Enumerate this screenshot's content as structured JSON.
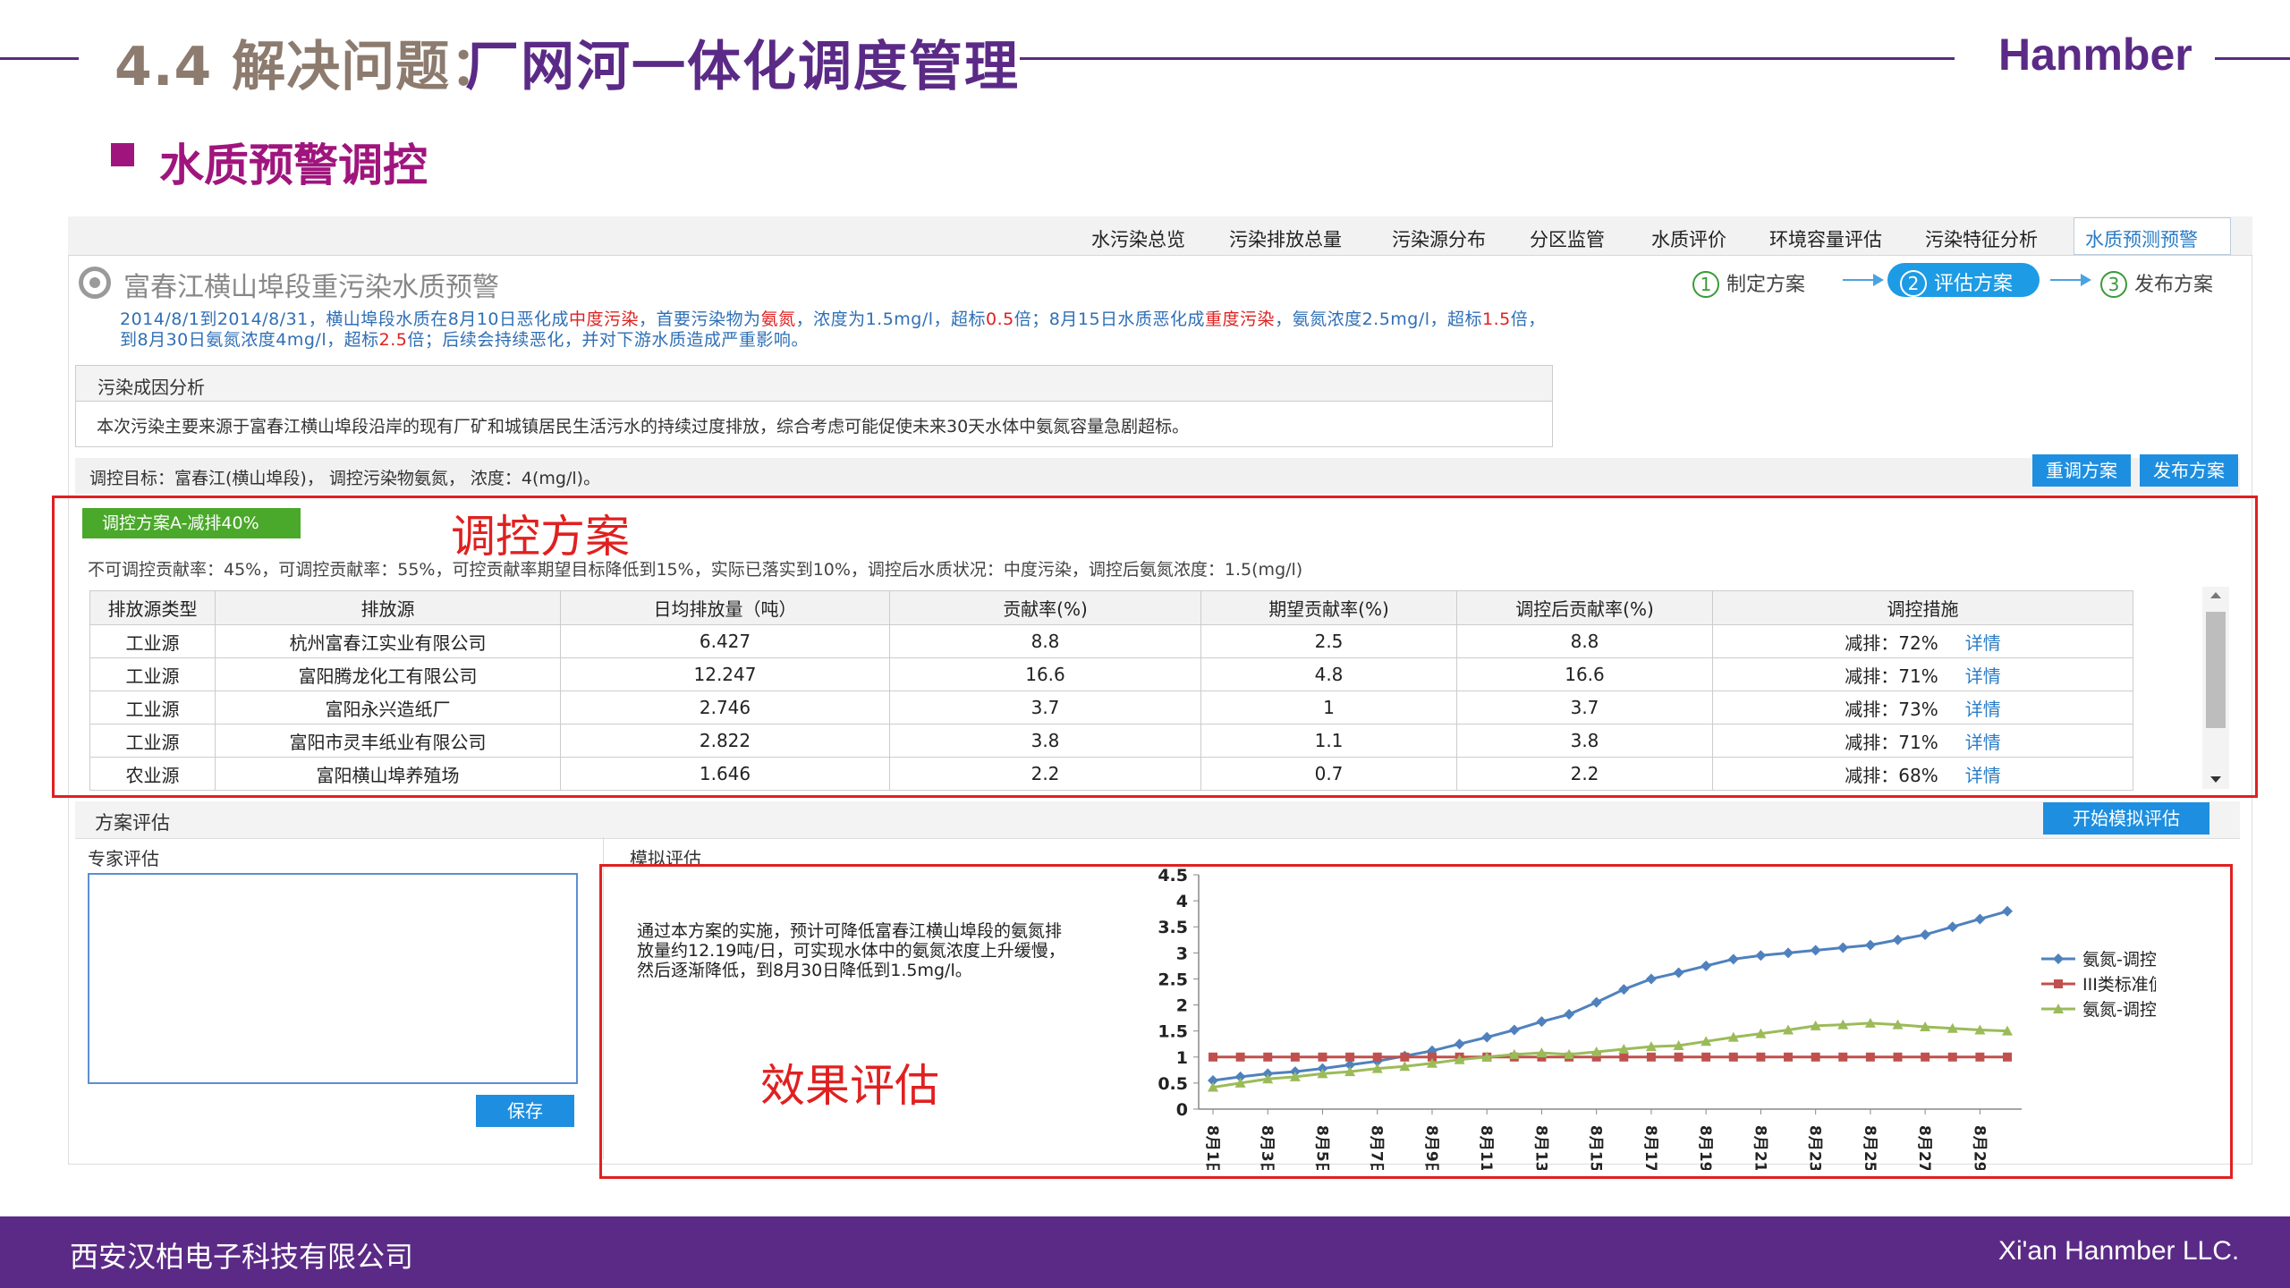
{
  "slide": {
    "title_num": "4.4 解决问题：",
    "title_main": "厂网河一体化调度管理",
    "brand": "Hanmber",
    "subtitle": "水质预警调控",
    "footer_left": "西安汉柏电子科技有限公司",
    "footer_right": "Xi'an Hanmber LLC."
  },
  "nav": {
    "items": [
      "水污染总览",
      "污染排放总量",
      "污染源分布",
      "分区监管",
      "水质评价",
      "环境容量评估",
      "污染特征分析"
    ],
    "active": "水质预测预警"
  },
  "alert": {
    "title": "富春江横山埠段重污染水质预警",
    "desc_parts": [
      {
        "t": "2014/8/1到2014/8/31，横山埠段水质在8月10日恶化成",
        "red": false
      },
      {
        "t": "中度污染",
        "red": true
      },
      {
        "t": "，首要污染物为",
        "red": false
      },
      {
        "t": "氨氮",
        "red": true
      },
      {
        "t": "，浓度为1.5mg/l，超标",
        "red": false
      },
      {
        "t": "0.5",
        "red": true
      },
      {
        "t": "倍；8月15日水质恶化成",
        "red": false
      },
      {
        "t": "重度污染",
        "red": true
      },
      {
        "t": "，氨氮浓度2.5mg/l，超标",
        "red": false
      },
      {
        "t": "1.5",
        "red": true
      },
      {
        "t": "倍，到8月30日氨氮浓度4mg/l，超标",
        "red": false
      },
      {
        "t": "2.5",
        "red": true
      },
      {
        "t": "倍；后续会持续恶化，并对下游水质造成严重影响。",
        "red": false
      }
    ]
  },
  "steps": {
    "s1": {
      "num": "1",
      "label": "制定方案"
    },
    "s2": {
      "num": "2",
      "label": "评估方案"
    },
    "s3": {
      "num": "3",
      "label": "发布方案"
    }
  },
  "cause": {
    "heading": "污染成因分析",
    "text": "本次污染主要来源于富春江横山埠段沿岸的现有厂矿和城镇居民生活污水的持续过度排放，综合考虑可能促使未来30天水体中氨氮容量急剧超标。"
  },
  "target": {
    "text": "调控目标：富春江(横山埠段)， 调控污染物氨氮， 浓度：4(mg/l)。",
    "btn_readjust": "重调方案",
    "btn_publish": "发布方案"
  },
  "plan": {
    "tag": "调控方案A-减排40%",
    "annotation": "调控方案",
    "desc": "不可调控贡献率：45%，可调控贡献率：55%，可控贡献率期望目标降低到15%，实际已落实到10%，调控后水质状况：中度污染，调控后氨氮浓度：1.5(mg/l)",
    "columns": [
      "排放源类型",
      "排放源",
      "日均排放量（吨）",
      "贡献率(%)",
      "期望贡献率(%)",
      "调控后贡献率(%)",
      "调控措施"
    ],
    "rows": [
      {
        "type": "工业源",
        "source": "杭州富春江实业有限公司",
        "daily": "6.427",
        "rate": "8.8",
        "expected": "2.5",
        "after": "8.8",
        "measure": "减排：72%",
        "link": "详情"
      },
      {
        "type": "工业源",
        "source": "富阳腾龙化工有限公司",
        "daily": "12.247",
        "rate": "16.6",
        "expected": "4.8",
        "after": "16.6",
        "measure": "减排：71%",
        "link": "详情"
      },
      {
        "type": "工业源",
        "source": "富阳永兴造纸厂",
        "daily": "2.746",
        "rate": "3.7",
        "expected": "1",
        "after": "3.7",
        "measure": "减排：73%",
        "link": "详情"
      },
      {
        "type": "工业源",
        "source": "富阳市灵丰纸业有限公司",
        "daily": "2.822",
        "rate": "3.8",
        "expected": "1.1",
        "after": "3.8",
        "measure": "减排：71%",
        "link": "详情"
      },
      {
        "type": "农业源",
        "source": "富阳横山埠养殖场",
        "daily": "1.646",
        "rate": "2.2",
        "expected": "0.7",
        "after": "2.2",
        "measure": "减排：68%",
        "link": "详情"
      }
    ]
  },
  "evaluation": {
    "heading": "方案评估",
    "start_btn": "开始模拟评估",
    "expert_title": "专家评估",
    "save_btn": "保存",
    "sim_title": "模拟评估",
    "sim_text": "通过本方案的实施，预计可降低富春江横山埠段的氨氮排放量约12.19吨/日，可实现水体中的氨氮浓度上升缓慢，然后逐渐降低，到8月30日降低到1.5mg/l。",
    "effect_annotation": "效果评估"
  },
  "chart_data": {
    "type": "line",
    "x": [
      "8月1日",
      "8月2日",
      "8月3日",
      "8月4日",
      "8月5日",
      "8月6日",
      "8月7日",
      "8月8日",
      "8月9日",
      "8月10日",
      "8月11日",
      "8月12日",
      "8月13日",
      "8月14日",
      "8月15日",
      "8月16日",
      "8月17日",
      "8月18日",
      "8月19日",
      "8月20日",
      "8月21日",
      "8月22日",
      "8月23日",
      "8月24日",
      "8月25日",
      "8月26日",
      "8月27日",
      "8月28日",
      "8月29日",
      "8月30日"
    ],
    "x_tick_labels": [
      "8月1日",
      "8月3日",
      "8月5日",
      "8月7日",
      "8月9日",
      "8月11日",
      "8月13日",
      "8月15日",
      "8月17日",
      "8月19日",
      "8月21日",
      "8月23日",
      "8月25日",
      "8月27日",
      "8月29日"
    ],
    "ylim": [
      0,
      4.5
    ],
    "yticks": [
      "0",
      "0.5",
      "1",
      "1.5",
      "2",
      "2.5",
      "3",
      "3.5",
      "4",
      "4.5"
    ],
    "series": [
      {
        "name": "氨氮-调控前",
        "color": "#4f81bd",
        "marker": "diamond",
        "values": [
          0.55,
          0.62,
          0.68,
          0.72,
          0.78,
          0.85,
          0.92,
          1.02,
          1.12,
          1.25,
          1.38,
          1.52,
          1.68,
          1.82,
          2.05,
          2.3,
          2.5,
          2.62,
          2.75,
          2.88,
          2.95,
          3.0,
          3.05,
          3.1,
          3.15,
          3.25,
          3.35,
          3.5,
          3.65,
          3.8
        ]
      },
      {
        "name": "III类标准值",
        "color": "#c0504d",
        "marker": "square",
        "values": [
          1,
          1,
          1,
          1,
          1,
          1,
          1,
          1,
          1,
          1,
          1,
          1,
          1,
          1,
          1,
          1,
          1,
          1,
          1,
          1,
          1,
          1,
          1,
          1,
          1,
          1,
          1,
          1,
          1,
          1
        ]
      },
      {
        "name": "氨氮-调控后",
        "color": "#9bbb59",
        "marker": "triangle",
        "values": [
          0.42,
          0.5,
          0.58,
          0.62,
          0.68,
          0.72,
          0.78,
          0.82,
          0.88,
          0.95,
          1.0,
          1.05,
          1.08,
          1.05,
          1.1,
          1.15,
          1.2,
          1.22,
          1.3,
          1.38,
          1.45,
          1.52,
          1.6,
          1.62,
          1.65,
          1.62,
          1.58,
          1.55,
          1.52,
          1.5
        ]
      }
    ],
    "legend_position": "right"
  }
}
